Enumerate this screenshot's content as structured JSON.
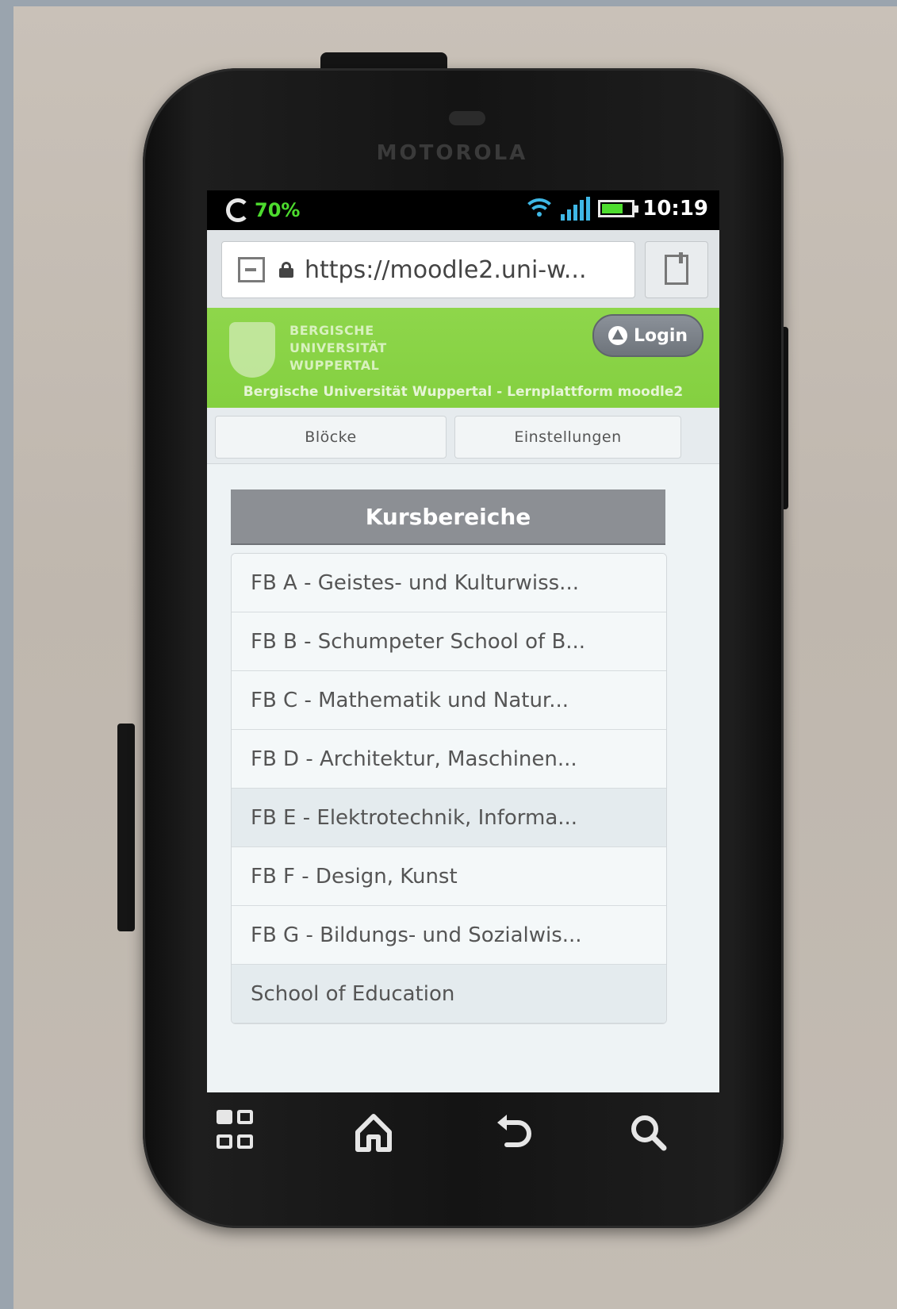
{
  "device": {
    "brand": "MOTOROLA"
  },
  "status_bar": {
    "battery_percent": "70%",
    "battery_level": 0.7,
    "time": "10:19",
    "accent_color": "#4ddc2e",
    "signal_color": "#3fb8e6"
  },
  "browser": {
    "url": "https://moodle2.uni-w...",
    "icons": [
      "page-icon",
      "lock-icon",
      "bookmark-icon"
    ]
  },
  "site_header": {
    "university_lines": [
      "BERGISCHE",
      "UNIVERSITÄT",
      "WUPPERTAL"
    ],
    "login_label": "Login",
    "site_title": "Bergische Universität Wuppertal - Lernplattform moodle2",
    "header_color": "#8ed64b"
  },
  "tabs": [
    {
      "label": "Blöcke"
    },
    {
      "label": "Einstellungen"
    }
  ],
  "section": {
    "title": "Kursbereiche",
    "items": [
      {
        "label": "FB A - Geistes- und Kulturwiss..."
      },
      {
        "label": "FB B - Schumpeter School of B..."
      },
      {
        "label": "FB C - Mathematik und Natur..."
      },
      {
        "label": "FB D - Architektur, Maschinen..."
      },
      {
        "label": "FB E - Elektrotechnik, Informa..."
      },
      {
        "label": "FB F - Design, Kunst"
      },
      {
        "label": "FB G - Bildungs- und Sozialwis..."
      },
      {
        "label": "School of Education"
      }
    ]
  },
  "nav_bar": {
    "icons": [
      "menu-icon",
      "home-icon",
      "back-icon",
      "search-icon"
    ]
  }
}
